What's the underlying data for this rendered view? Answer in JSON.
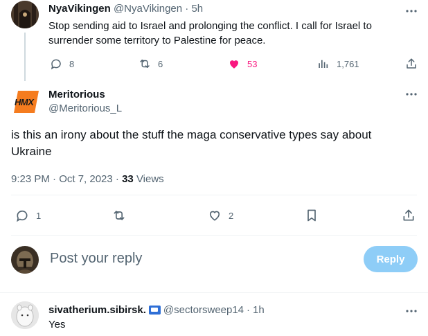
{
  "parent_tweet": {
    "display_name": "NyaVikingen",
    "handle": "@NyaVikingen",
    "time": "5h",
    "text": "Stop sending aid to Israel and prolonging the conflict. I call for Israel to surrender some territory to Palestine for peace.",
    "replies": "8",
    "reposts": "6",
    "likes": "53",
    "views": "1,761",
    "like_color": "#f91880"
  },
  "main_tweet": {
    "display_name": "Meritorious",
    "handle": "@Meritorious_L",
    "avatar_text": "HMX",
    "text": "is this an irony about the stuff the maga conservative types say about Ukraine",
    "timestamp": "9:23 PM · Oct 7, 2023 · ",
    "view_count": "33",
    "views_label": "Views",
    "replies": "1",
    "likes": "2"
  },
  "compose": {
    "placeholder": "Post your reply",
    "button_label": "Reply",
    "button_color": "#8ecdf7"
  },
  "reply_tweet": {
    "display_name": "sivatherium.sibirsk.",
    "handle": "@sectorsweep14",
    "time": "1h",
    "text": "Yes"
  },
  "colors": {
    "text": "#0f1419",
    "muted": "#536471",
    "divider": "#eff3f4",
    "thread_line": "#cfd9de"
  }
}
